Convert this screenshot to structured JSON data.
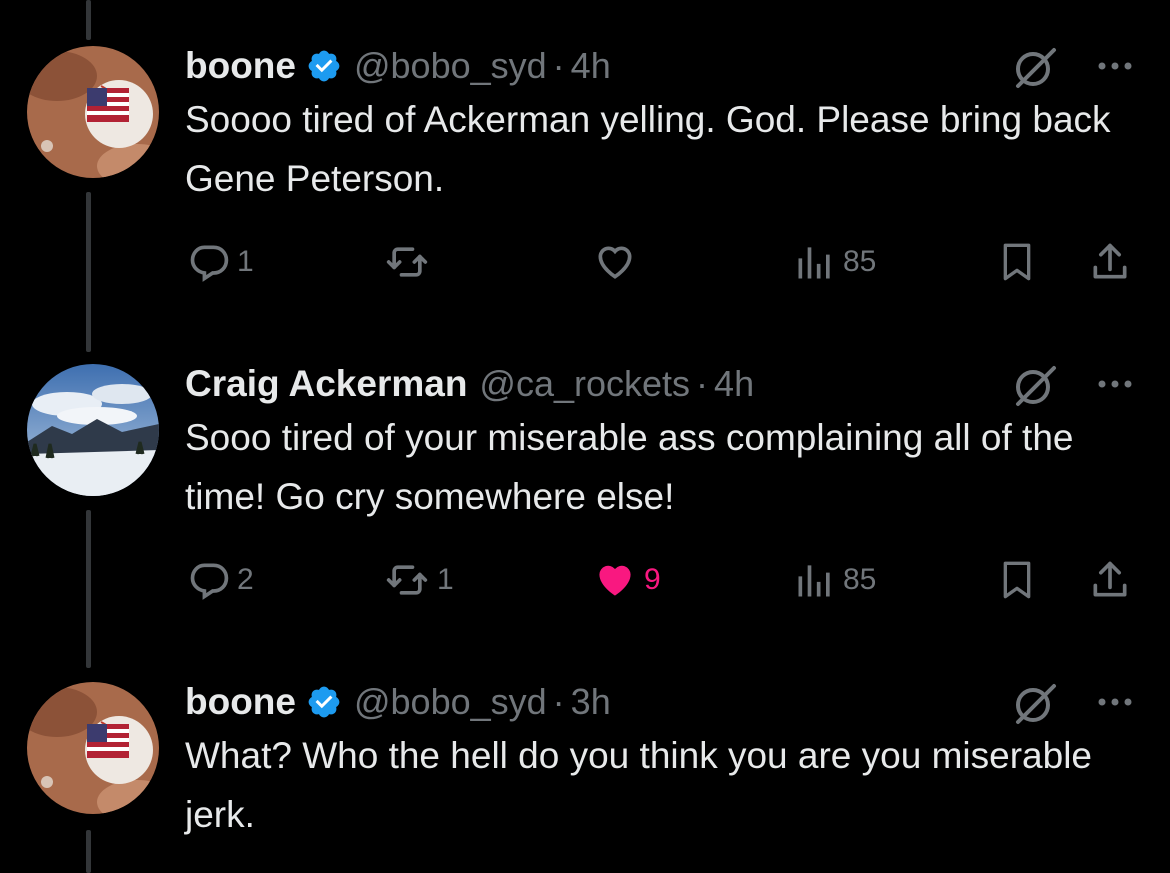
{
  "tweets": [
    {
      "name": "boone",
      "verified": true,
      "handle": "@bobo_syd",
      "time": "4h",
      "text": "Soooo tired of Ackerman yelling. God. Please bring back Gene Peterson.",
      "replies": "1",
      "reposts": "",
      "likes": "",
      "liked": false,
      "views": "85",
      "avatar": "baseball-flag-avatar"
    },
    {
      "name": "Craig Ackerman",
      "verified": false,
      "handle": "@ca_rockets",
      "time": "4h",
      "text": "Sooo tired of your miserable ass complaining all of the time! Go cry somewhere else!",
      "replies": "2",
      "reposts": "1",
      "likes": "9",
      "liked": true,
      "views": "85",
      "avatar": "mountain-snow-avatar"
    },
    {
      "name": "boone",
      "verified": true,
      "handle": "@bobo_syd",
      "time": "3h",
      "text": "What? Who the hell do you think you are you miserable jerk.",
      "avatar": "baseball-flag-avatar"
    }
  ],
  "separator": "·",
  "colors": {
    "background": "#000000",
    "text": "#e7e9ea",
    "muted": "#71767b",
    "verified": "#1d9bf0",
    "like": "#f91880",
    "thread_line": "#333639"
  },
  "icons": [
    "reply-icon",
    "repost-icon",
    "like-icon",
    "views-icon",
    "bookmark-icon",
    "share-icon",
    "grok-icon",
    "more-icon",
    "verified-badge-icon"
  ]
}
